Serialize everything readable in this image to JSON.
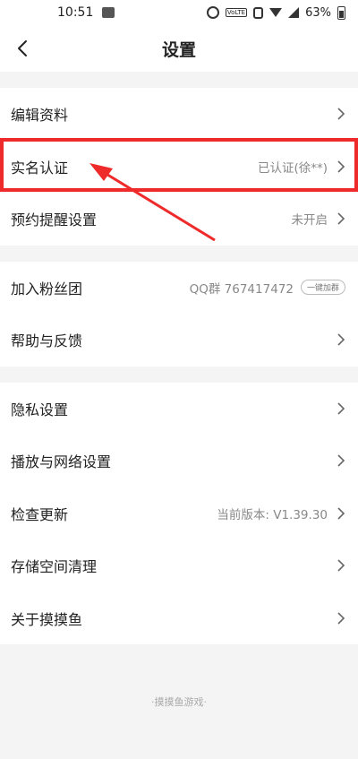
{
  "status_bar": {
    "time": "10:51",
    "battery": "63%",
    "network": "4G"
  },
  "header": {
    "title": "设置"
  },
  "groups": [
    {
      "items": [
        {
          "label": "编辑资料",
          "value": ""
        },
        {
          "label": "实名认证",
          "value": "已认证(徐**)"
        },
        {
          "label": "预约提醒设置",
          "value": "未开启"
        }
      ]
    },
    {
      "items": [
        {
          "label": "加入粉丝团",
          "value": "QQ群 767417472",
          "action": "一键加群"
        },
        {
          "label": "帮助与反馈",
          "value": ""
        }
      ]
    },
    {
      "items": [
        {
          "label": "隐私设置",
          "value": ""
        },
        {
          "label": "播放与网络设置",
          "value": ""
        },
        {
          "label": "检查更新",
          "value": "当前版本: V1.39.30"
        },
        {
          "label": "存储空间清理",
          "value": ""
        },
        {
          "label": "关于摸摸鱼",
          "value": ""
        }
      ]
    }
  ],
  "footer": {
    "text": "·摸摸鱼游戏·"
  },
  "annotation": {
    "highlight_color": "#ee2a2a"
  }
}
